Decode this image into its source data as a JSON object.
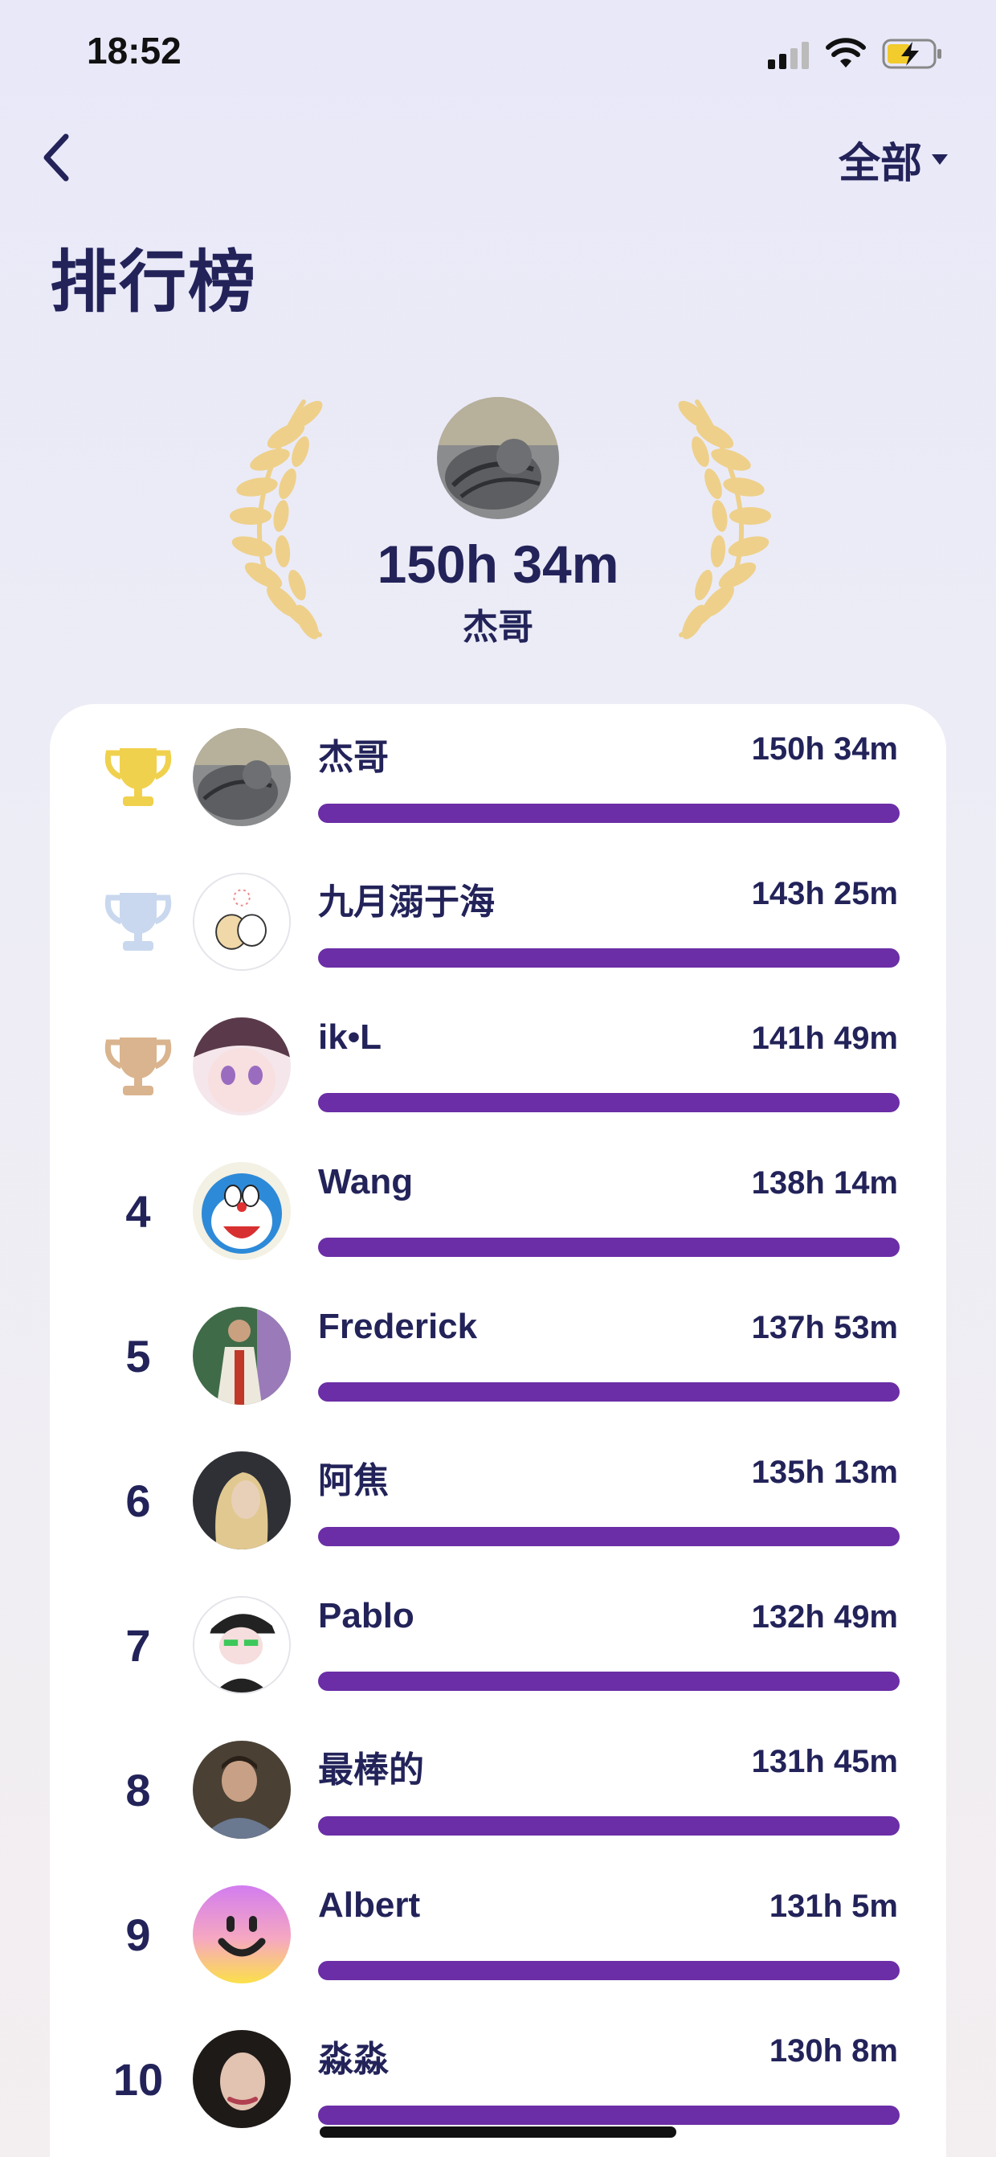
{
  "status": {
    "time": "18:52"
  },
  "header": {
    "filter_label": "全部",
    "title": "排行榜"
  },
  "leader": {
    "time": "150h 34m",
    "name": "杰哥"
  },
  "colors": {
    "bar": "#6b2ea6",
    "title": "#23235a",
    "gold": "#f0d14e",
    "silver": "#c9d8ee",
    "bronze": "#d9b48e",
    "laurel": "#eed08a"
  },
  "rows": [
    {
      "rank": "1",
      "trophy": "gold-trophy-icon",
      "name": "杰哥",
      "time": "150h 34m",
      "progress": 1.0,
      "avatar": "cat-avatar"
    },
    {
      "rank": "2",
      "trophy": "silver-trophy-icon",
      "name": "九月溺于海",
      "time": "143h 25m",
      "progress": 1.0,
      "avatar": "dogs-avatar"
    },
    {
      "rank": "3",
      "trophy": "bronze-trophy-icon",
      "name": "ik•L",
      "time": "141h 49m",
      "progress": 1.0,
      "avatar": "anime-girl-avatar"
    },
    {
      "rank": "4",
      "name": "Wang",
      "time": "138h 14m",
      "progress": 1.0,
      "avatar": "doraemon-avatar"
    },
    {
      "rank": "5",
      "name": "Frederick",
      "time": "137h 53m",
      "progress": 1.0,
      "avatar": "person-avatar"
    },
    {
      "rank": "6",
      "name": "阿焦",
      "time": "135h 13m",
      "progress": 1.0,
      "avatar": "blonde-person-avatar"
    },
    {
      "rank": "7",
      "name": "Pablo",
      "time": "132h 49m",
      "progress": 1.0,
      "avatar": "cartoon-boy-avatar"
    },
    {
      "rank": "8",
      "name": "最棒的",
      "time": "131h 45m",
      "progress": 1.0,
      "avatar": "selfie-avatar"
    },
    {
      "rank": "9",
      "name": "Albert",
      "time": "131h 5m",
      "progress": 1.0,
      "avatar": "smiley-avatar"
    },
    {
      "rank": "10",
      "name": "淼淼",
      "time": "130h 8m",
      "progress": 1.0,
      "avatar": "woman-avatar"
    }
  ]
}
